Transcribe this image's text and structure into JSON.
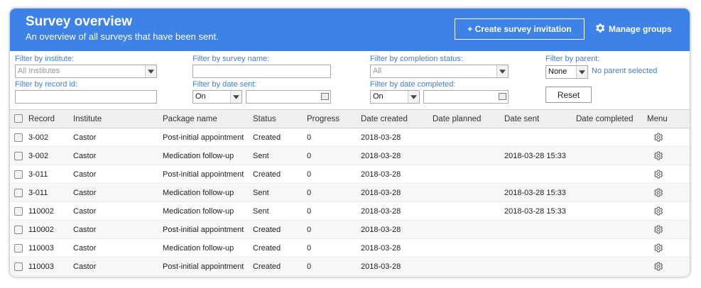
{
  "header": {
    "title": "Survey overview",
    "subtitle": "An overview of all surveys that have been sent.",
    "create_button": "+ Create survey invitation",
    "manage_groups": "Manage groups"
  },
  "filters": {
    "institute": {
      "label": "Filter by institute:",
      "value": "All Institutes"
    },
    "survey_name": {
      "label": "Filter by survey name:",
      "value": ""
    },
    "completion_status": {
      "label": "Filter by completion status:",
      "value": "All"
    },
    "parent": {
      "label": "Filter by parent:",
      "value": "None",
      "note": "No parent selected"
    },
    "record_id": {
      "label": "Filter by record id:",
      "value": ""
    },
    "date_sent": {
      "label": "Filter by date sent:",
      "mode": "On",
      "value": ""
    },
    "date_completed": {
      "label": "Filter by date completed:",
      "mode": "On",
      "value": ""
    },
    "reset_button": "Reset"
  },
  "table": {
    "columns": [
      "Record",
      "Institute",
      "Package name",
      "Status",
      "Progress",
      "Date created",
      "Date planned",
      "Date sent",
      "Date completed",
      "Menu"
    ],
    "rows": [
      [
        "3-002",
        "Castor",
        "Post-initial appointment",
        "Created",
        "0",
        "2018-03-28",
        "",
        "",
        ""
      ],
      [
        "3-002",
        "Castor",
        "Medication follow-up",
        "Sent",
        "0",
        "2018-03-28",
        "",
        "2018-03-28 15:33",
        ""
      ],
      [
        "3-011",
        "Castor",
        "Post-initial appointment",
        "Created",
        "0",
        "2018-03-28",
        "",
        "",
        ""
      ],
      [
        "3-011",
        "Castor",
        "Medication follow-up",
        "Sent",
        "0",
        "2018-03-28",
        "",
        "2018-03-28 15:33",
        ""
      ],
      [
        "110002",
        "Castor",
        "Medication follow-up",
        "Sent",
        "0",
        "2018-03-28",
        "",
        "2018-03-28 15:33",
        ""
      ],
      [
        "110002",
        "Castor",
        "Post-initial appointment",
        "Created",
        "0",
        "2018-03-28",
        "",
        "",
        ""
      ],
      [
        "110003",
        "Castor",
        "Medication follow-up",
        "Created",
        "0",
        "2018-03-28",
        "",
        "",
        ""
      ],
      [
        "110003",
        "Castor",
        "Post-initial appointment",
        "Created",
        "0",
        "2018-03-28",
        "",
        "",
        ""
      ]
    ]
  },
  "colors": {
    "header_bg": "#3d82e6",
    "label_blue": "#3e7fd4"
  },
  "icons": {
    "gear": "gear-icon",
    "dropdown": "chevron-down-icon",
    "calendar": "calendar-icon"
  }
}
